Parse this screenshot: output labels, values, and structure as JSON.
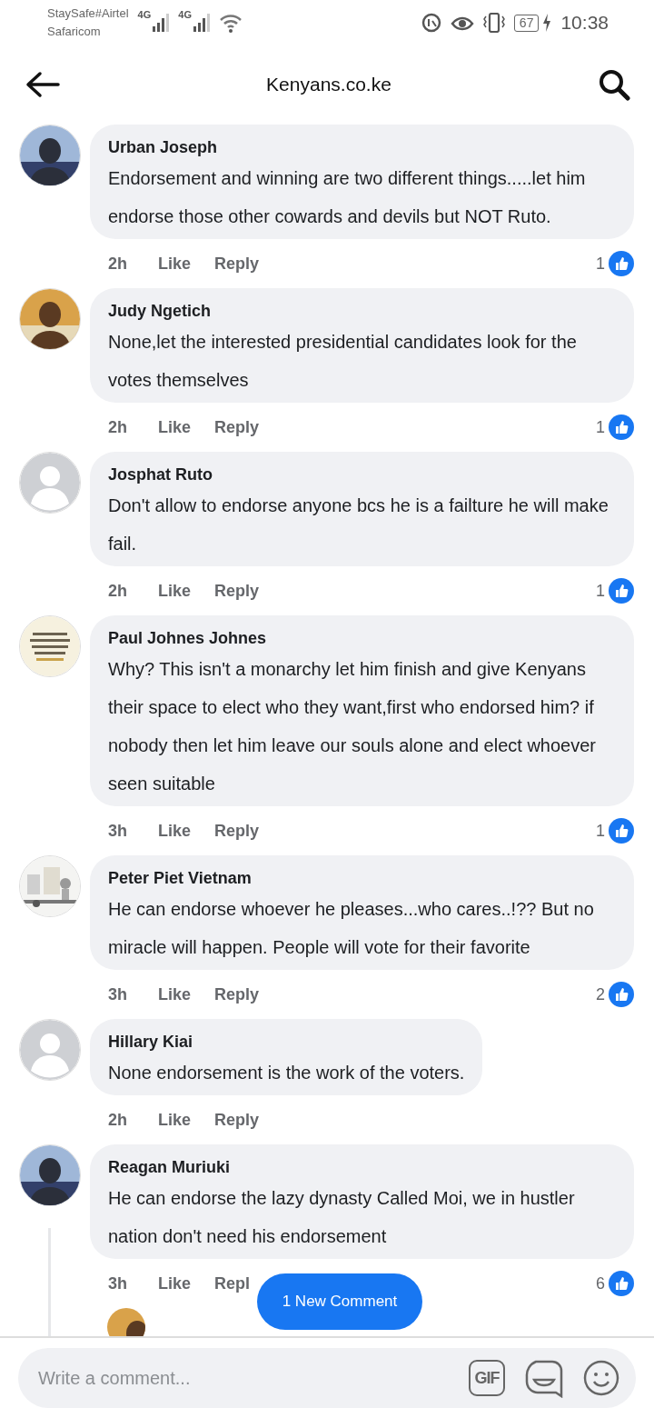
{
  "status_bar": {
    "carriers": [
      "StaySafe#Airtel",
      "Safaricom"
    ],
    "network_labels": [
      "4G",
      "4G"
    ],
    "battery": "67",
    "time": "10:38"
  },
  "header": {
    "title": "Kenyans.co.ke"
  },
  "comments": [
    {
      "author": "Urban Joseph",
      "text": "Endorsement and winning are two different things.....let him endorse those other cowards and devils but NOT Ruto.",
      "time": "2h",
      "like_label": "Like",
      "reply_label": "Reply",
      "like_count": "1"
    },
    {
      "author": "Judy Ngetich",
      "text": "None,let the interested presidential candidates look for the votes themselves",
      "time": "2h",
      "like_label": "Like",
      "reply_label": "Reply",
      "like_count": "1"
    },
    {
      "avatar": {
        "kind": "default"
      },
      "author": "Josphat Ruto",
      "text": "Don't allow to endorse anyone bcs he is a failture he will make fail.",
      "time": "2h",
      "like_label": "Like",
      "reply_label": "Reply",
      "like_count": "1"
    },
    {
      "avatar": {
        "kind": "card"
      },
      "author": "Paul Johnes Johnes",
      "text": "Why? This isn't a monarchy let him finish and give Kenyans their space to elect who they want,first who endorsed him? if nobody then let him leave our souls alone and elect whoever seen suitable",
      "time": "3h",
      "like_label": "Like",
      "reply_label": "Reply",
      "like_count": "1"
    },
    {
      "avatar": {
        "kind": "sketch"
      },
      "author": "Peter Piet Vietnam",
      "text": "He can endorse whoever he pleases...who cares..!?? But no miracle will happen. People will vote for their favorite",
      "time": "3h",
      "like_label": "Like",
      "reply_label": "Reply",
      "like_count": "2"
    },
    {
      "avatar": {
        "kind": "default"
      },
      "author": "Hillary Kiai",
      "text": "None endorsement is the work of the voters.",
      "time": "2h",
      "like_label": "Like",
      "reply_label": "Reply"
    },
    {
      "author": "Reagan Muriuki",
      "text": "He can endorse the lazy dynasty Called Moi, we in hustler nation don't need his endorsement",
      "time": "3h",
      "like_label": "Like",
      "reply_label": "Repl",
      "like_count": "6"
    }
  ],
  "new_comment_button": "1 New Comment",
  "composer": {
    "placeholder": "Write a comment...",
    "gif_label": "GIF"
  }
}
